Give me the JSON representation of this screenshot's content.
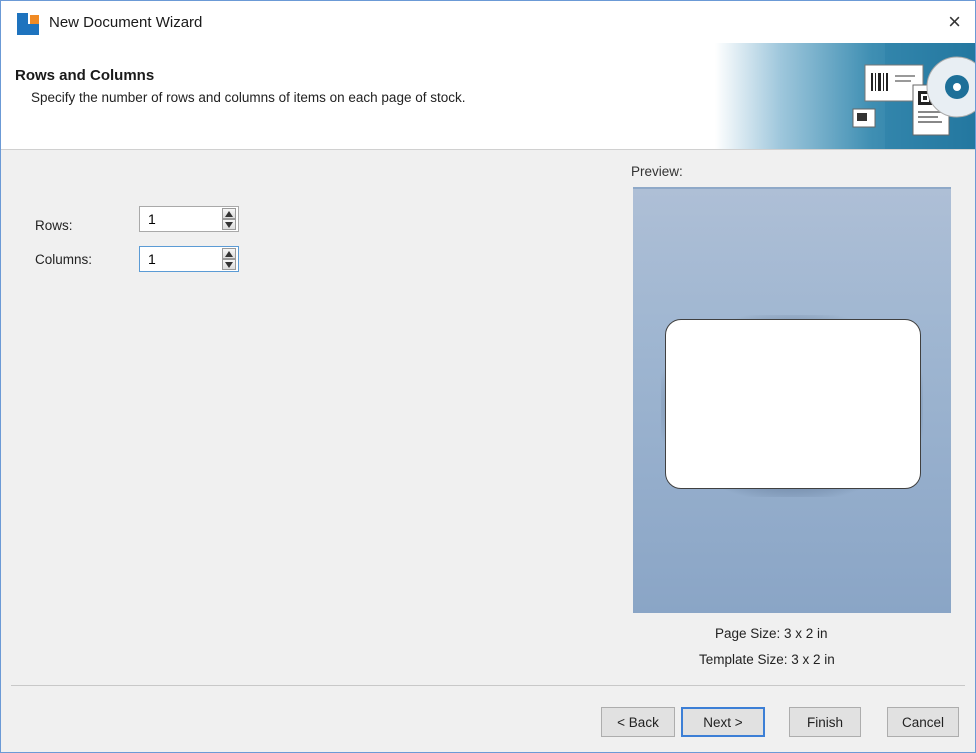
{
  "window": {
    "title": "New Document Wizard",
    "close_glyph": "×"
  },
  "header": {
    "title": "Rows and Columns",
    "subtitle": "Specify the number of rows and columns of items on each page of stock."
  },
  "form": {
    "rows_label": "Rows:",
    "rows_value": "1",
    "columns_label": "Columns:",
    "columns_value": "1"
  },
  "preview": {
    "label": "Preview:",
    "page_size": "Page Size:  3 x 2 in",
    "template_size": "Template Size:  3 x 2 in"
  },
  "buttons": {
    "back": "< Back",
    "next": "Next >",
    "finish": "Finish",
    "cancel": "Cancel"
  },
  "icons": {
    "app": "wizard-app-icon",
    "close": "close-icon",
    "spin_up": "spin-up-icon",
    "spin_down": "spin-down-icon"
  },
  "colors": {
    "accent": "#3c7fd6",
    "app_icon_blue": "#1e73be",
    "app_icon_orange": "#f08a24",
    "preview_bg": "#9fb6d1"
  }
}
